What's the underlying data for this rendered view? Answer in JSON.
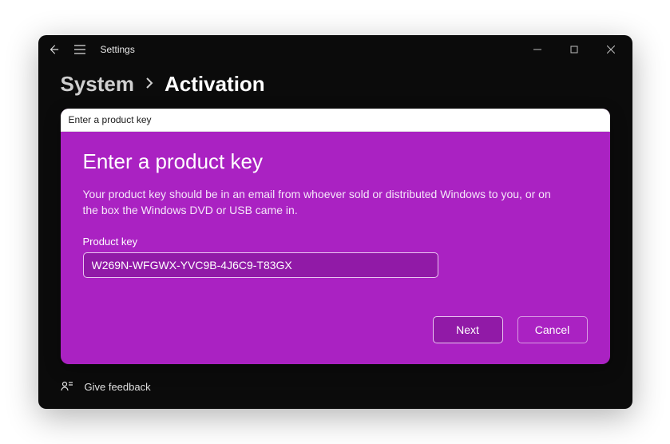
{
  "titlebar": {
    "app_name": "Settings"
  },
  "breadcrumb": {
    "root": "System",
    "current": "Activation"
  },
  "feedback": {
    "label": "Give feedback"
  },
  "dialog": {
    "window_title": "Enter a product key",
    "heading": "Enter a product key",
    "description": "Your product key should be in an email from whoever sold or distributed Windows to you, or on the box the Windows DVD or USB came in.",
    "field_label": "Product key",
    "product_key_value": "W269N-WFGWX-YVC9B-4J6C9-T83GX",
    "next_label": "Next",
    "cancel_label": "Cancel"
  },
  "colors": {
    "accent": "#aa22c2",
    "accent_dark": "#911aa7",
    "window_bg": "#0b0b0b"
  }
}
